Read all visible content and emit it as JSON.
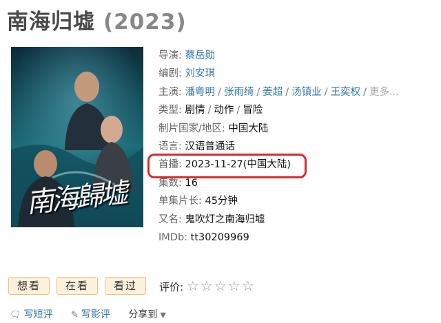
{
  "title": "南海归墟",
  "year": "(2023)",
  "poster": {
    "calligraphy": "南海歸墟"
  },
  "info": {
    "director_label": "导演",
    "director": "蔡岳勋",
    "writer_label": "编剧",
    "writer": "刘安琪",
    "cast_label": "主演",
    "cast": [
      "潘粤明",
      "张雨绮",
      "姜超",
      "汤镇业",
      "王奕权"
    ],
    "cast_more": "更多...",
    "genre_label": "类型",
    "genres": [
      "剧情",
      "动作",
      "冒险"
    ],
    "country_label": "制片国家/地区",
    "country": "中国大陆",
    "language_label": "语言",
    "language": "汉语普通话",
    "premiere_label": "首播",
    "premiere": "2023-11-27(中国大陆)",
    "episodes_label": "集数",
    "episodes": "16",
    "runtime_label": "单集片长",
    "runtime": "45分钟",
    "aka_label": "又名",
    "aka": "鬼吹灯之南海归墟",
    "imdb_label": "IMDb",
    "imdb": "tt30209969"
  },
  "actions": {
    "want": "想看",
    "watching": "在看",
    "watched": "看过",
    "rating_label": "评价:",
    "stars": 5
  },
  "social": {
    "short_review": "写短评",
    "review": "写影评",
    "share": "分享到"
  },
  "colors": {
    "link": "#3377aa",
    "highlight": "#d9282a",
    "button_bg": "#fdf1dc"
  }
}
